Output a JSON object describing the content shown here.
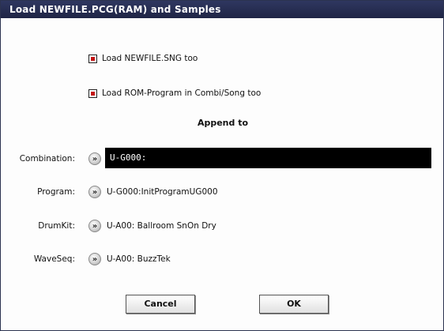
{
  "dialog": {
    "title": "Load NEWFILE.PCG(RAM) and Samples"
  },
  "options": [
    {
      "label": "Load NEWFILE.SNG too",
      "checked": true
    },
    {
      "label": "Load ROM-Program in Combi/Song too",
      "checked": true
    }
  ],
  "append": {
    "heading": "Append to",
    "rows": [
      {
        "label": "Combination:",
        "value": "U-G000:"
      },
      {
        "label": "Program:",
        "value": "U-G000:InitProgramUG000"
      },
      {
        "label": "DrumKit:",
        "value": "U-A00: Ballroom SnOn Dry"
      },
      {
        "label": "WaveSeq:",
        "value": "U-A00: BuzzTek"
      }
    ]
  },
  "buttons": {
    "cancel": "Cancel",
    "ok": "OK"
  },
  "colors": {
    "title_bg": "#2f3760",
    "checkbox_mark": "#c41414",
    "input_bg": "#000000"
  },
  "icons": {
    "arrow": "chevron-right-icon"
  }
}
